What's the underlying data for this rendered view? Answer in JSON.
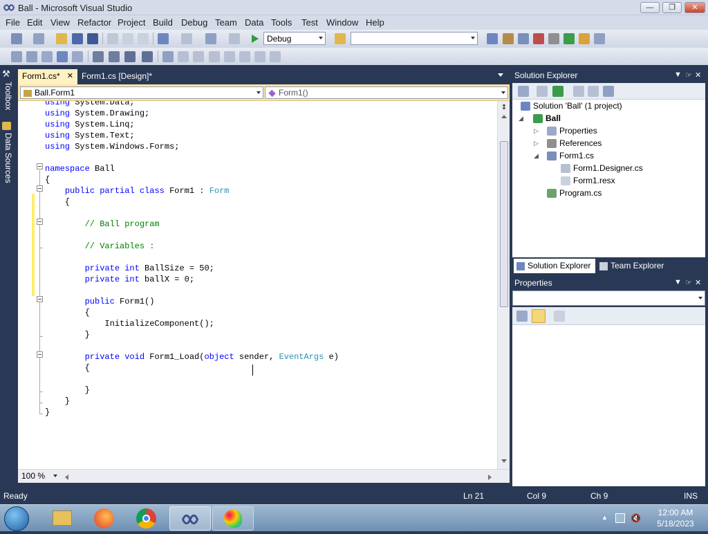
{
  "window": {
    "title": "Ball - Microsoft Visual Studio",
    "controls": [
      "minimize-icon",
      "restore-icon",
      "close-icon"
    ]
  },
  "menu": [
    "File",
    "Edit",
    "View",
    "Refactor",
    "Project",
    "Build",
    "Debug",
    "Team",
    "Data",
    "Tools",
    "Test",
    "Window",
    "Help"
  ],
  "toolbar": {
    "config": "Debug",
    "platform": ""
  },
  "left_tabs": [
    "Toolbox",
    "Data Sources"
  ],
  "doc_tabs": [
    {
      "label": "Form1.cs*",
      "active": true
    },
    {
      "label": "Form1.cs [Design]*",
      "active": false
    }
  ],
  "nav": {
    "type": "Ball.Form1",
    "member": "Form1()"
  },
  "code": [
    "using System.Data;",
    "using System.Drawing;",
    "using System.Linq;",
    "using System.Text;",
    "using System.Windows.Forms;",
    "",
    "namespace Ball",
    "{",
    "    public partial class Form1 : Form",
    "    {",
    "",
    "        // Ball program",
    "",
    "        // Variables :",
    "",
    "        private int BallSize = 50;",
    "        private int ballX = 0;",
    "",
    "        public Form1()",
    "        {",
    "            InitializeComponent();",
    "        }",
    "",
    "        private void Form1_Load(object sender, EventArgs e)",
    "        {",
    "",
    "        }",
    "    }",
    "}"
  ],
  "zoom": "100 %",
  "solution_explorer": {
    "title": "Solution Explorer",
    "nodes": [
      {
        "label": "Solution 'Ball' (1 project)",
        "icon": "solution-icon"
      },
      {
        "label": "Ball",
        "icon": "csharp-project-icon"
      },
      {
        "label": "Properties",
        "icon": "properties-folder-icon"
      },
      {
        "label": "References",
        "icon": "references-icon"
      },
      {
        "label": "Form1.cs",
        "icon": "form-icon"
      },
      {
        "label": "Form1.Designer.cs",
        "icon": "cs-file-icon"
      },
      {
        "label": "Form1.resx",
        "icon": "resx-file-icon"
      },
      {
        "label": "Program.cs",
        "icon": "cs-file-icon"
      }
    ]
  },
  "pane_tabs": [
    "Solution Explorer",
    "Team Explorer"
  ],
  "properties": {
    "title": "Properties",
    "object": ""
  },
  "status": {
    "text": "Ready",
    "ln": "Ln 21",
    "col": "Col 9",
    "ch": "Ch 9",
    "mode": "INS"
  },
  "clock": {
    "time": "12:00 AM",
    "date": "5/18/2023"
  },
  "taskbar_apps": [
    "windows-start-icon",
    "file-explorer-icon",
    "firefox-icon",
    "chrome-icon",
    "visual-studio-icon",
    "paint-icon"
  ],
  "colors": {
    "chrome": "#293955",
    "keyword": "#0000ff",
    "type": "#2b91af",
    "comment": "#008000",
    "active_tab": "#fff1c1"
  }
}
